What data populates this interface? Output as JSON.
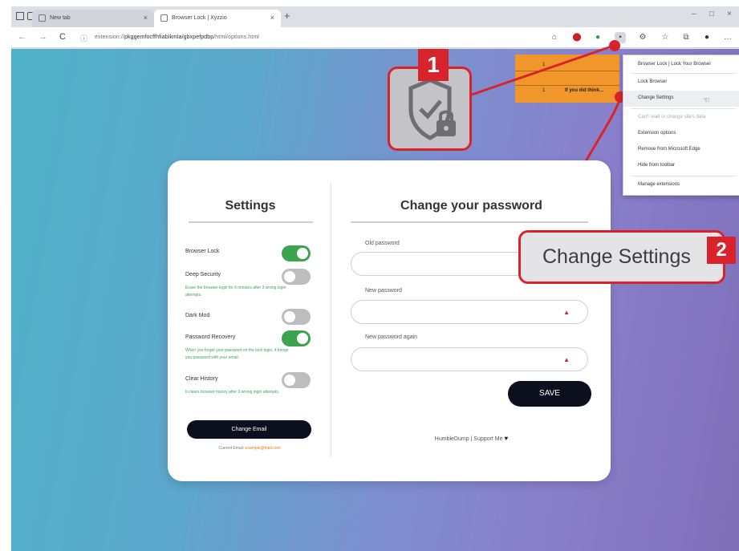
{
  "browser": {
    "tabs": [
      {
        "title": "New tab"
      },
      {
        "title": "Browser Lock | Xyzzio"
      }
    ],
    "new_tab_symbol": "+",
    "tab_close_symbol": "×",
    "window_controls": [
      "–",
      "□",
      "×"
    ],
    "url_prefix": "extension://",
    "url_id": "pkggemfocffhfiablkmla/gbxpefpdbp",
    "url_path": "/html/options.html"
  },
  "callouts": {
    "step1": "1",
    "step2": "2",
    "change_settings_label": "Change Settings"
  },
  "orange_strip": {
    "rows": [
      {
        "num": "1",
        "text": ""
      },
      {
        "num": "1",
        "text": "If you did think…"
      }
    ]
  },
  "extension_menu": {
    "items": [
      {
        "label": "Browser Lock | Lock Your Browser",
        "disabled": false
      },
      {
        "label": "Lock Browser",
        "disabled": false
      },
      {
        "label": "Change Settings",
        "disabled": false,
        "highlighted": true
      },
      {
        "label": "Can't read or change site's data",
        "disabled": true
      },
      {
        "label": "Extension options",
        "disabled": false
      },
      {
        "label": "Remove from Microsoft Edge",
        "disabled": false
      },
      {
        "label": "Hide from toolbar",
        "disabled": false
      },
      {
        "label": "Manage extensions",
        "disabled": false
      }
    ]
  },
  "settings": {
    "title": "Settings",
    "options": [
      {
        "label": "Browser Lock",
        "enabled": true,
        "description": ""
      },
      {
        "label": "Deep Security",
        "enabled": false,
        "description": "Erase the browser login for 5 minutes after 3 wrong login attempts."
      },
      {
        "label": "Dark Mod",
        "enabled": false,
        "description": ""
      },
      {
        "label": "Password Recovery",
        "enabled": true,
        "description": "When you forget your password on the lock login, it brings you password with your email."
      },
      {
        "label": "Clear History",
        "enabled": false,
        "description": "It clears browser history after 3 wrong login attempts."
      }
    ],
    "change_email_label": "Change Email",
    "current_email_label": "Current Email:",
    "current_email_value": "example@mail.com"
  },
  "password": {
    "title": "Change your password",
    "fields": [
      {
        "label": "Old password",
        "value": "",
        "warning": false
      },
      {
        "label": "New password",
        "value": "",
        "warning": true
      },
      {
        "label": "New password again",
        "value": "",
        "warning": true
      }
    ],
    "warning_symbol": "▲",
    "save_label": "SAVE",
    "support_text": "HumbleDump | Support Me",
    "heart": "♥"
  },
  "colors": {
    "accent_red": "#d9232c",
    "toggle_on": "#3ca34f",
    "button_dark": "#0b0f1e",
    "orange": "#f0962b"
  },
  "icons": [
    "grid-icon",
    "tab-icon",
    "back-icon",
    "forward-icon",
    "refresh-icon",
    "info-icon",
    "shield-lock-icon",
    "gear-icon",
    "star-icon",
    "collections-icon",
    "profile-icon",
    "more-icon",
    "cursor-icon",
    "heart-icon",
    "warning-icon"
  ]
}
